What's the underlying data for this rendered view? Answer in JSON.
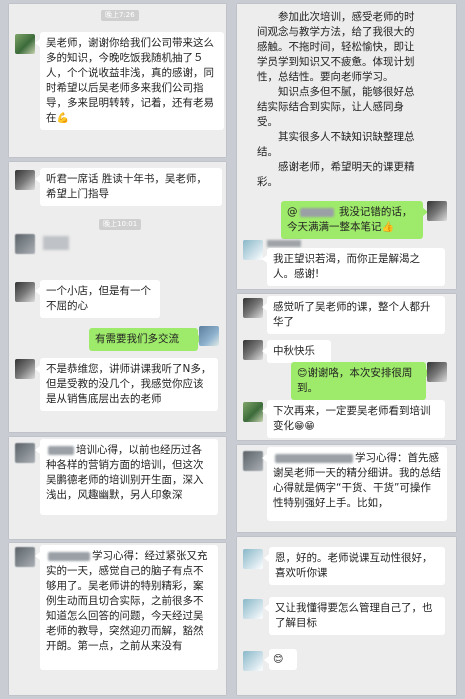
{
  "p1": {
    "time": "晚上7:26",
    "msg": "吴老师，谢谢你给我们公司带来这么多的知识，今晚吃饭我随机抽了５人，个个说收益非浅，真的感谢，同时希望以后吴老师多来我们公司指导，多来昆明转转，记着，还有老易在",
    "emoji": "💪"
  },
  "p2": {
    "msg1": "听君一席话 胜读十年书，吴老师，希望上门指导",
    "time": "晚上10:01",
    "msg2": "一个小店，但是有一个不屈的心",
    "msg3": "有需要我们多交流",
    "msg4": "不是恭维您，讲师讲课我听了N多，但是受教的没几个，我感觉你应该是从销售底层出去的老师"
  },
  "p3": {
    "text": "培训心得，以前也经历过各种各样的营销方面的培训，但这次吴鹏德老师的培训别开生面，深入浅出，风趣幽默，另人印象深"
  },
  "p4": {
    "text": "学习心得：经过紧张又充实的一天，感觉自己的脑子有点不够用了。吴老师讲的特别精彩，案例生动而且切合实际，之前很多不知道怎么回答的问题，今天经过吴老师的教导，突然迎刃而解，豁然开朗。第一点，之前从来没有"
  },
  "p5": {
    "para1": "参加此次培训，感受老师的时间观念与教学方法，给了我很大的感触。不拖时间，轻松愉快，即让学员学到知识又不疲惫。体现计划性，总结性。要向老师学习。",
    "para2": "知识点多但不腻，能够很好总结实际结合到实际，让人感同身受。",
    "para3": "其实很多人不缺知识缺整理总结。",
    "para4": "感谢老师，希望明天的课更精彩。",
    "green_line1": "@",
    "green_line1b": " 我没记错的话，",
    "green_line2": "今天满满一整本笔记",
    "reply": "我正望识若渴，而你正是解渴之人。感谢!"
  },
  "p6": {
    "msg1": "感觉听了吴老师的课，整个人都升华了",
    "msg2": "中秋快乐",
    "green": "谢谢咯，本次安排很周到。",
    "msg3": "下次再来，一定要吴老师看到培训变化"
  },
  "p7": {
    "text": "学习心得：首先感谢吴老师一天的精分细讲。我的总结心得就是俩字“干货、干货”可操作性特别强好上手。比如，"
  },
  "p8": {
    "msg1": "恩，好的。老师说课互动性很好，喜欢听你课",
    "msg2": "又让我懂得要怎么管理自己了，也了解目标",
    "emoji": "😊"
  },
  "colors": {
    "green_bubble": "#9eea6a",
    "panel_bg": "#ededed",
    "page_bg": "#c9ccd3"
  }
}
